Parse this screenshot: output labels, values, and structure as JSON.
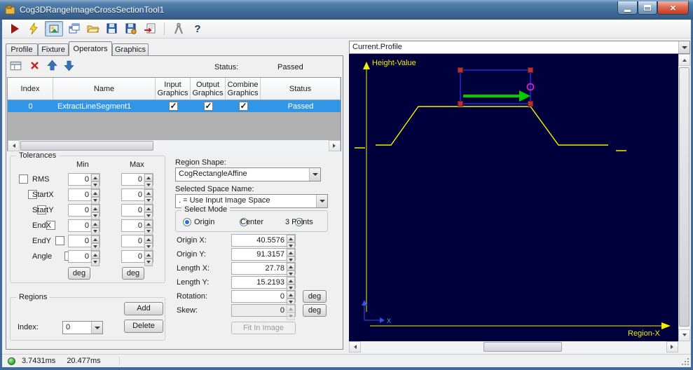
{
  "window": {
    "title": "Cog3DRangeImageCrossSectionTool1"
  },
  "toolbar": {
    "buttons": [
      "run",
      "electric-run",
      "image-display",
      "new-window",
      "open",
      "save",
      "save-image",
      "import",
      "calibrate",
      "help"
    ]
  },
  "tabs": [
    {
      "label": "Profile",
      "active": false
    },
    {
      "label": "Fixture",
      "active": false
    },
    {
      "label": "Operators",
      "active": true
    },
    {
      "label": "Graphics",
      "active": false
    }
  ],
  "operators": {
    "status_label": "Status:",
    "status_value": "Passed",
    "table": {
      "columns": [
        {
          "l1": "Index",
          "l2": ""
        },
        {
          "l1": "Name",
          "l2": ""
        },
        {
          "l1": "Input",
          "l2": "Graphics"
        },
        {
          "l1": "Output",
          "l2": "Graphics"
        },
        {
          "l1": "Combine",
          "l2": "Graphics"
        },
        {
          "l1": "Status",
          "l2": ""
        }
      ],
      "row": {
        "index": "0",
        "name": "ExtractLineSegment1",
        "input_graphics": true,
        "output_graphics": true,
        "combine_graphics": true,
        "status": "Passed",
        "selected": true
      }
    }
  },
  "tolerances": {
    "title": "Tolerances",
    "min_header": "Min",
    "max_header": "Max",
    "rows": [
      {
        "label": "RMS",
        "min": "0",
        "max": "0",
        "checked": false
      },
      {
        "label": "StartX",
        "min": "0",
        "max": "0",
        "checked": false
      },
      {
        "label": "StartY",
        "min": "0",
        "max": "0",
        "checked": false
      },
      {
        "label": "EndX",
        "min": "0",
        "max": "0",
        "checked": false
      },
      {
        "label": "EndY",
        "min": "0",
        "max": "0",
        "checked": false
      },
      {
        "label": "Angle",
        "min": "0",
        "max": "0",
        "checked": false
      }
    ],
    "min_unit_button": "deg",
    "max_unit_button": "deg"
  },
  "regions": {
    "title": "Regions",
    "index_label": "Index:",
    "index_value": "0",
    "add_button": "Add",
    "delete_button": "Delete"
  },
  "shape": {
    "region_shape_label": "Region Shape:",
    "region_shape_value": "CogRectangleAffine",
    "space_label": "Selected Space Name:",
    "space_value": ". = Use Input Image Space",
    "select_mode_title": "Select Mode",
    "modes": [
      {
        "label": "Origin",
        "selected": true
      },
      {
        "label": "Center",
        "selected": false
      },
      {
        "label": "3 Points",
        "selected": false
      }
    ],
    "fields": [
      {
        "label": "Origin X:",
        "value": "40.5576"
      },
      {
        "label": "Origin Y:",
        "value": "91.3157"
      },
      {
        "label": "Length X:",
        "value": "27.78"
      },
      {
        "label": "Length Y:",
        "value": "15.2193"
      },
      {
        "label": "Rotation:",
        "value": "0",
        "unit": "deg"
      },
      {
        "label": "Skew:",
        "value": "0",
        "unit": "deg",
        "disabled": true
      }
    ],
    "fit_button": "Fit In Image",
    "fit_button_enabled": false
  },
  "profile_view": {
    "selector_value": "Current.Profile",
    "y_axis_label": "Height-Value",
    "x_axis_label": "Region-X",
    "mini_axis_label": "X"
  },
  "statusbar": {
    "time1": "3.7431ms",
    "time2": "20.477ms"
  },
  "colors": {
    "selection_blue": "#3296e8",
    "plot_background": "#00003c",
    "profile_yellow": "#f0f000",
    "region_blue": "#2a2ad2",
    "handle_red": "#b43232",
    "arrow_green": "#00cc00",
    "marker_magenta": "#c322c3",
    "status_green": "#3fae3f"
  }
}
